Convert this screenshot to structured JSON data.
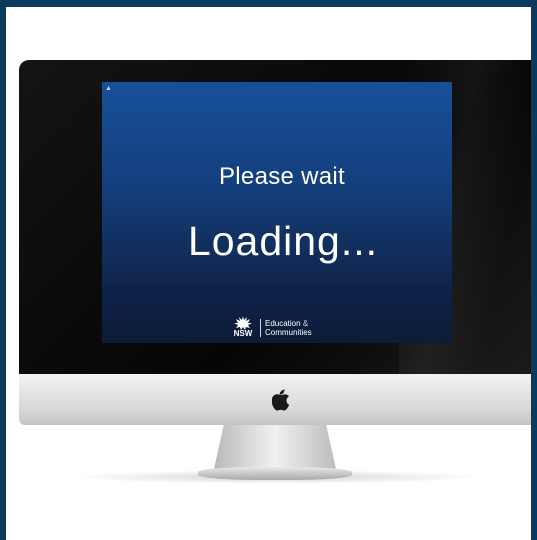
{
  "screen": {
    "message": "Please wait",
    "status": "Loading..."
  },
  "logo": {
    "mark": "NSW",
    "line1": "Education",
    "amp": "&",
    "line2": "Communities"
  },
  "icons": {
    "cursor": "cursor-arrow-icon",
    "waratah": "waratah-icon",
    "apple": "apple-logo-icon"
  },
  "colors": {
    "frame": "#0b3a5c",
    "screen_top": "#17509a",
    "screen_bottom": "#0c1b38"
  }
}
